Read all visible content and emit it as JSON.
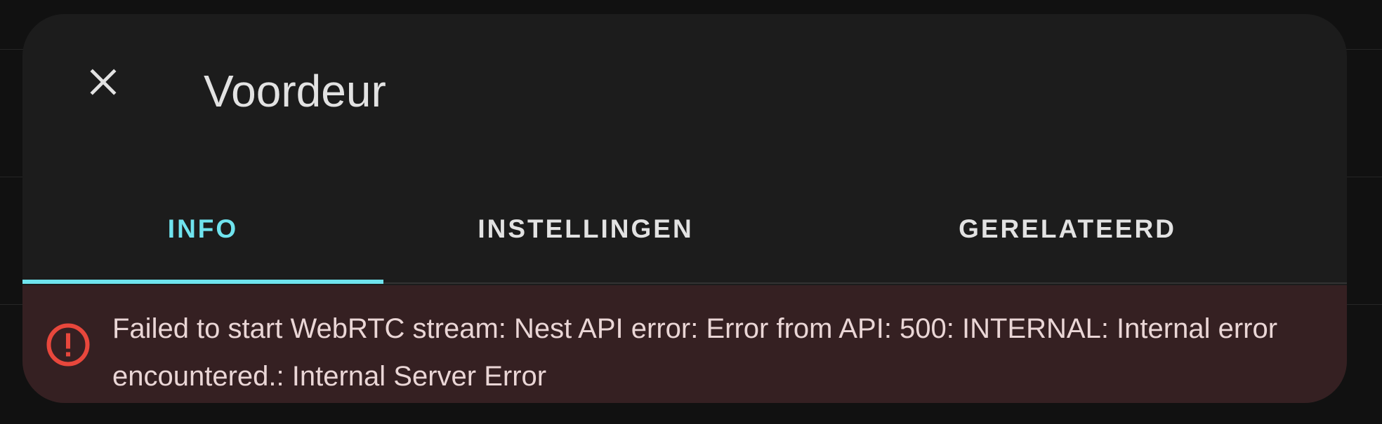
{
  "dialog": {
    "title": "Voordeur",
    "close_icon": "close-icon"
  },
  "tabs": [
    {
      "label": "INFO",
      "active": true
    },
    {
      "label": "INSTELLINGEN",
      "active": false
    },
    {
      "label": "GERELATEERD",
      "active": false
    }
  ],
  "alert": {
    "icon": "alert-circle-icon",
    "message": "Failed to start WebRTC stream: Nest API error: Error from API: 500: INTERNAL: Internal error encountered.: Internal Server Error"
  },
  "colors": {
    "accent": "#6fe3ee",
    "error": "#e8473c",
    "dialog_background": "#1c1c1c",
    "alert_background": "#352022"
  }
}
